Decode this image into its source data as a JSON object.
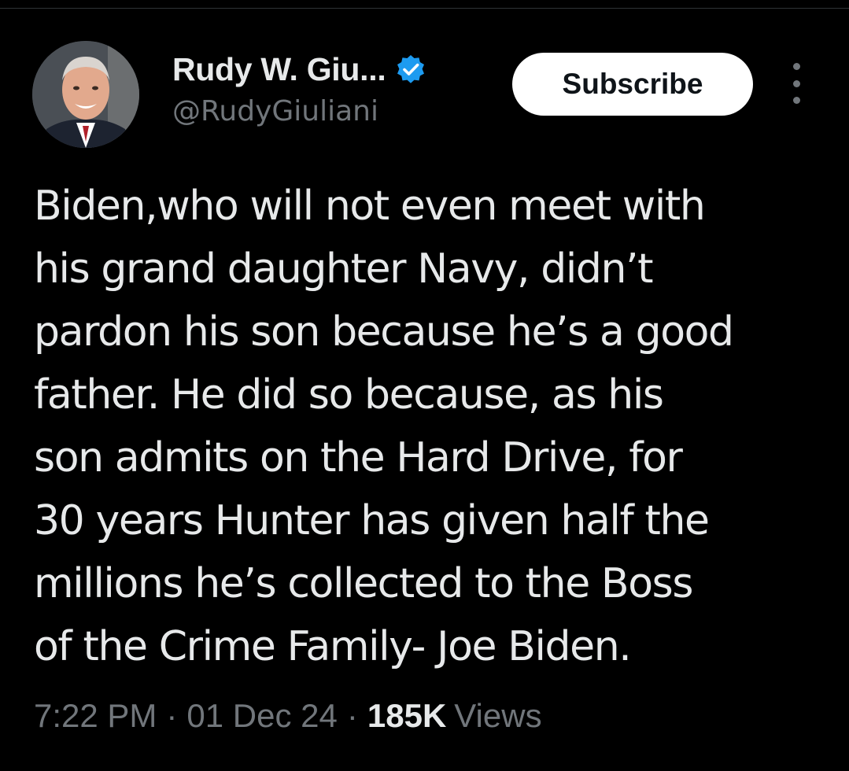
{
  "author": {
    "display_name": "Rudy W. Giu...",
    "handle": "@RudyGiuliani",
    "verified_icon": "verified-badge-icon",
    "verified_color": "#1d9bf0"
  },
  "header": {
    "subscribe_label": "Subscribe",
    "more_icon": "more-vertical-icon"
  },
  "tweet": {
    "lines": [
      "Biden,who will not even meet with",
      "his grand daughter Navy, didn’t",
      "pardon his son because he’s a good",
      "father. He did so because, as his",
      "son admits on the Hard Drive, for",
      "30 years Hunter has given half the",
      "millions he’s collected to the Boss",
      "of the Crime Family- Joe Biden."
    ]
  },
  "meta": {
    "time": "7:22 PM",
    "separator": "·",
    "date": "01 Dec 24",
    "views_count": "185K",
    "views_label": "Views"
  },
  "theme": {
    "background": "#000000",
    "text_primary": "#e7e9ea",
    "text_secondary": "#71767b",
    "button_bg": "#ffffff",
    "button_text": "#0f1419"
  }
}
